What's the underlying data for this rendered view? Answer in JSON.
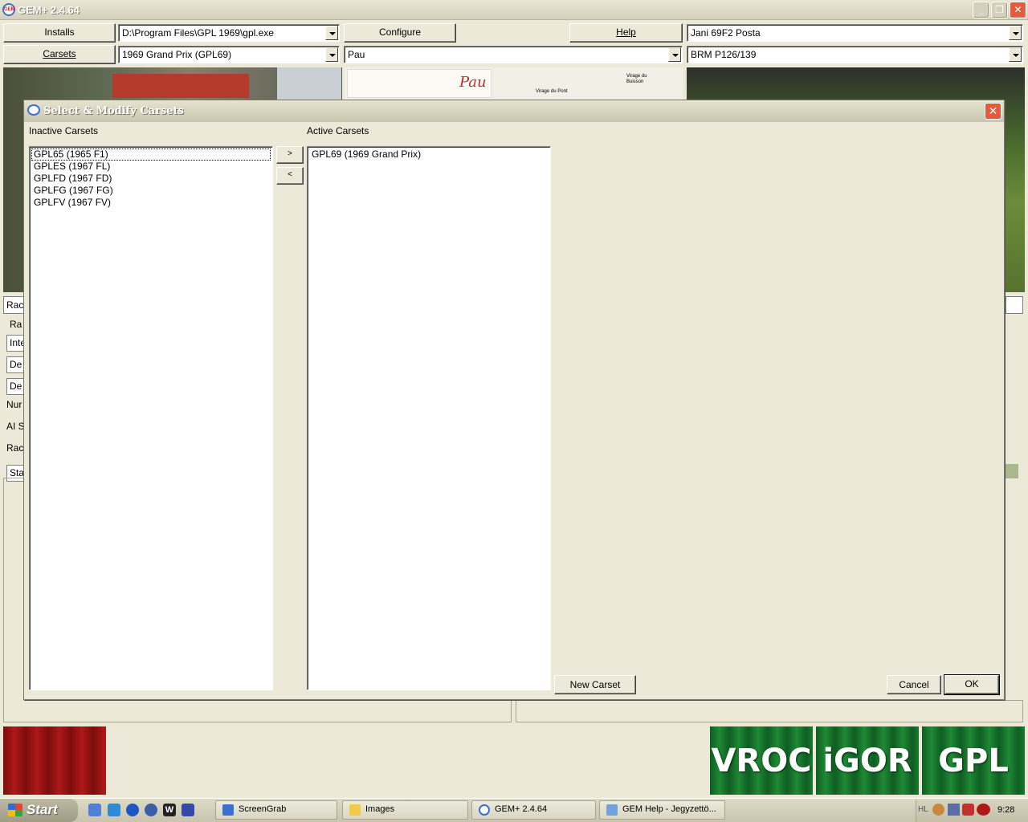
{
  "window": {
    "title": "GEM+ 2.4.64"
  },
  "toolbar": {
    "installs_label": "Installs",
    "install_path": "D:\\Program Files\\GPL 1969\\gpl.exe",
    "configure_label": "Configure",
    "help_label": "Help",
    "player_value": "Jani 69F2 Posta",
    "carsets_label": "Carsets",
    "carset_value": "1969 Grand Prix (GPL69)",
    "track_value": "Pau",
    "car_value": "BRM P126/139"
  },
  "preview": {
    "track_label": "Pau",
    "map_note_1": "Virage du Pont",
    "map_note_2": "Virage du Buisson"
  },
  "background_fragments": [
    "Rac",
    "Ra",
    "Inte",
    "De",
    "De",
    "Nur",
    "AI S",
    "Rac",
    "Sta"
  ],
  "dialog": {
    "title": "Select & Modify Carsets",
    "close_symbol": "✕",
    "inactive_label": "Inactive Carsets",
    "active_label": "Active Carsets",
    "move_right_label": ">",
    "move_left_label": "<",
    "inactive_items": [
      "GPL65 (1965 F1)",
      "GPLES (1967 FL)",
      "GPLFD (1967 FD)",
      "GPLFG (1967 FG)",
      "GPLFV (1967 FV)"
    ],
    "active_items": [
      "GPL69 (1969 Grand Prix)"
    ],
    "new_carset_label": "New Carset",
    "cancel_label": "Cancel",
    "ok_label": "OK"
  },
  "logos": {
    "vroc": "VROC",
    "igor": "iGOR",
    "gpl": "GPL"
  },
  "taskbar": {
    "start_label": "Start",
    "tasks": [
      "ScreenGrab",
      "Images",
      "GEM+ 2.4.64",
      "GEM Help - Jegyzettö..."
    ],
    "lang": "HL",
    "clock": "9:28"
  },
  "colors": {
    "face": "#ece9d8",
    "logo_green": "#1e8a34",
    "logo_red": "#b01818",
    "dialog_close": "#e45a3a"
  }
}
